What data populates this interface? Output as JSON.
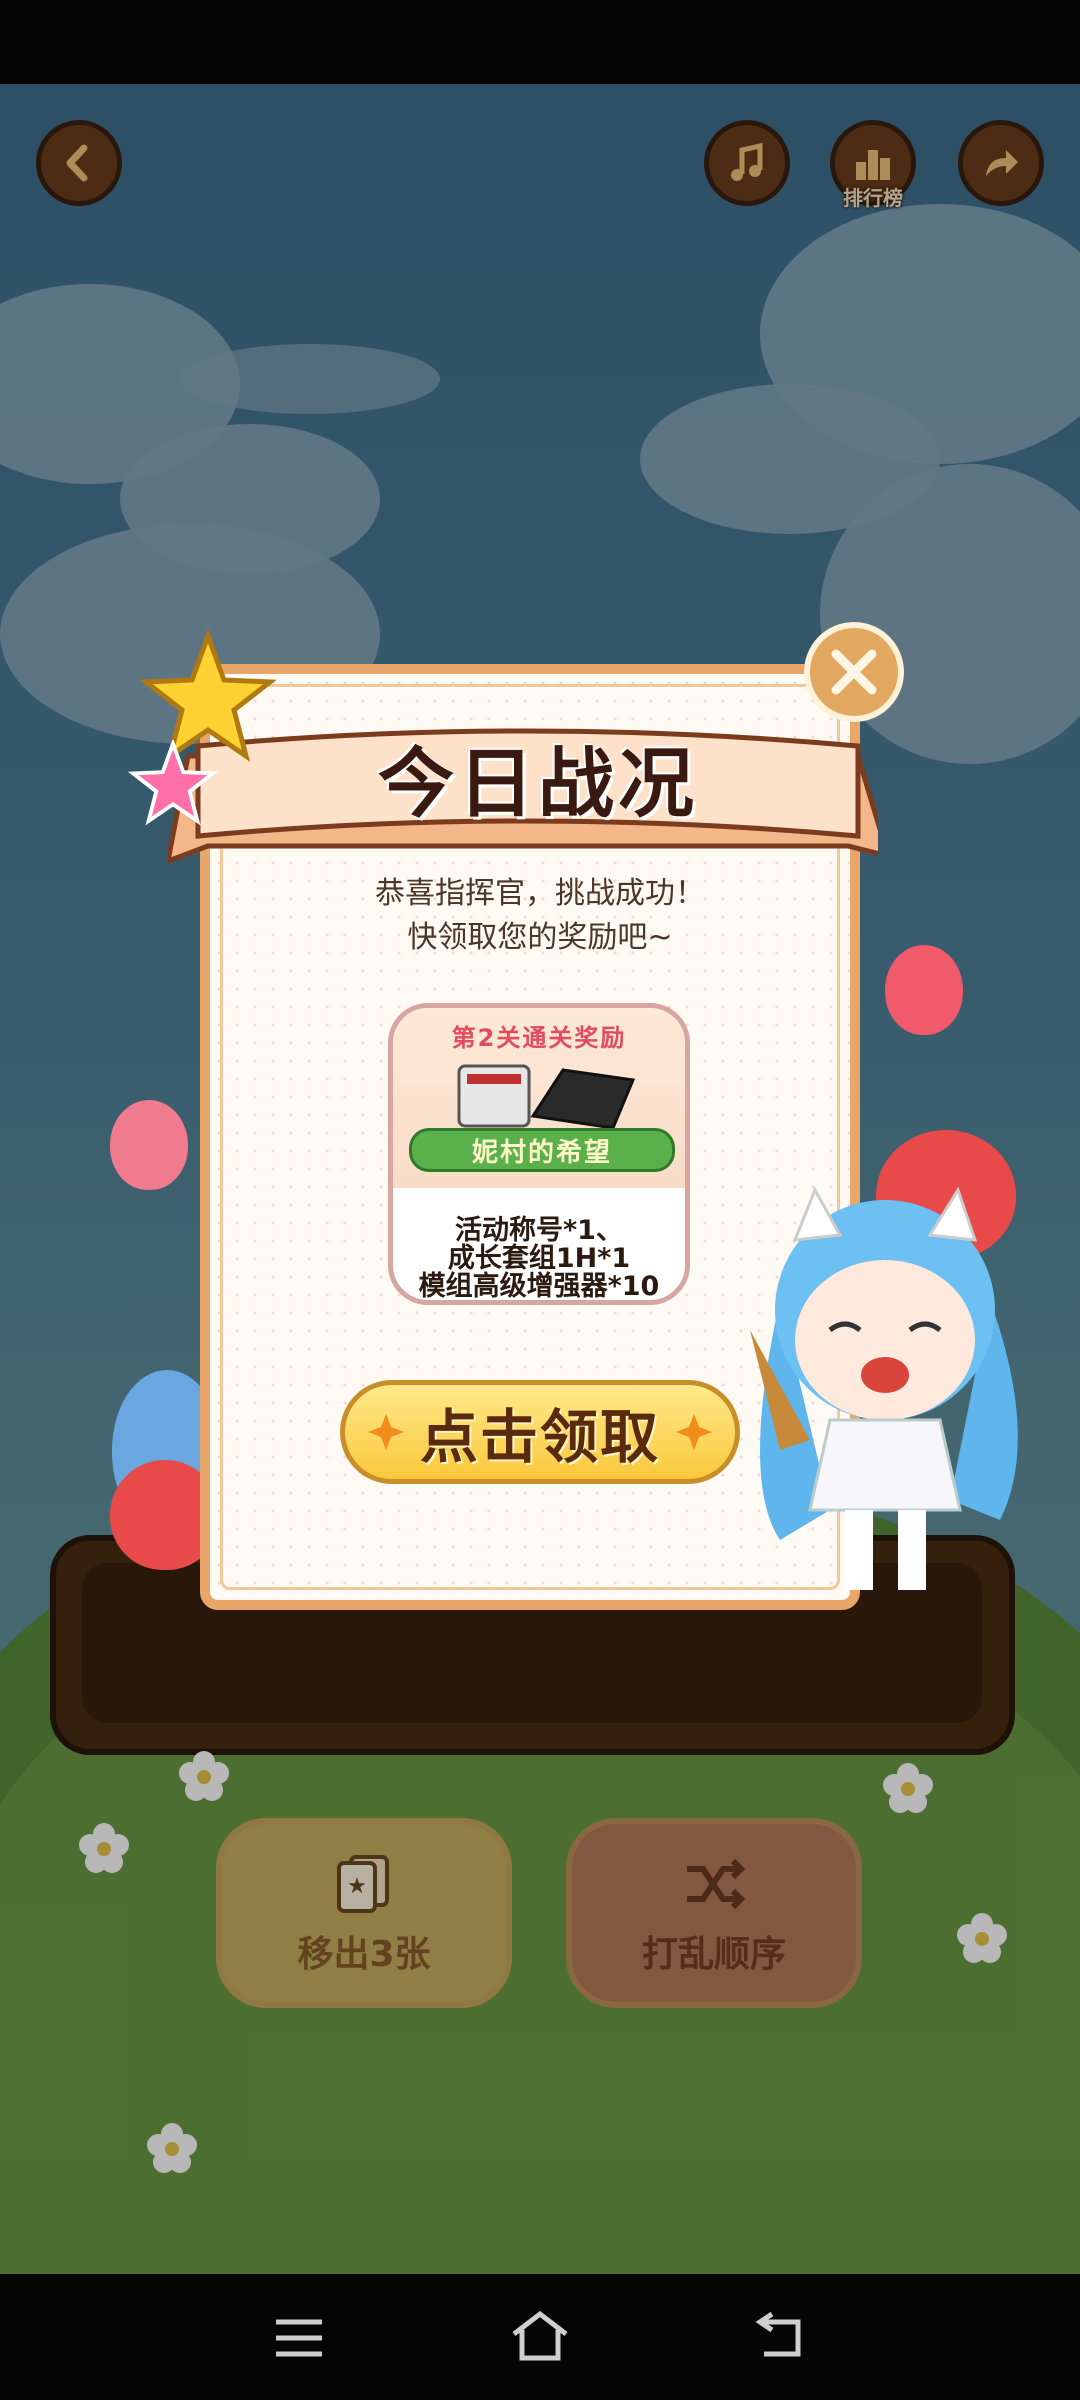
{
  "toolbar": {
    "back_icon": "back-arrow-icon",
    "music_icon": "music-note-icon",
    "rank_icon": "leaderboard-icon",
    "rank_label": "排行榜",
    "share_icon": "share-arrow-icon"
  },
  "bottom_buttons": [
    {
      "label": "移出3张",
      "icon": "card-stack-icon"
    },
    {
      "label": "打乱顺序",
      "icon": "shuffle-icon"
    }
  ],
  "dialog": {
    "title": "今日战况",
    "message_line1": "恭喜指挥官，挑战成功！",
    "message_line2": "快领取您的奖励吧~",
    "reward": {
      "header": "第2关通关奖励",
      "banner": "妮村的希望",
      "items": [
        "活动称号*1、",
        "成长套组1H*1",
        "模组高级增强器*10"
      ]
    },
    "claim_label": "点击领取",
    "close_icon": "close-icon"
  },
  "colors": {
    "accent": "#e8a66a",
    "button_yellow": "#f9c83c",
    "title_dark": "#3a1a10",
    "reward_red": "#e24c5e"
  }
}
